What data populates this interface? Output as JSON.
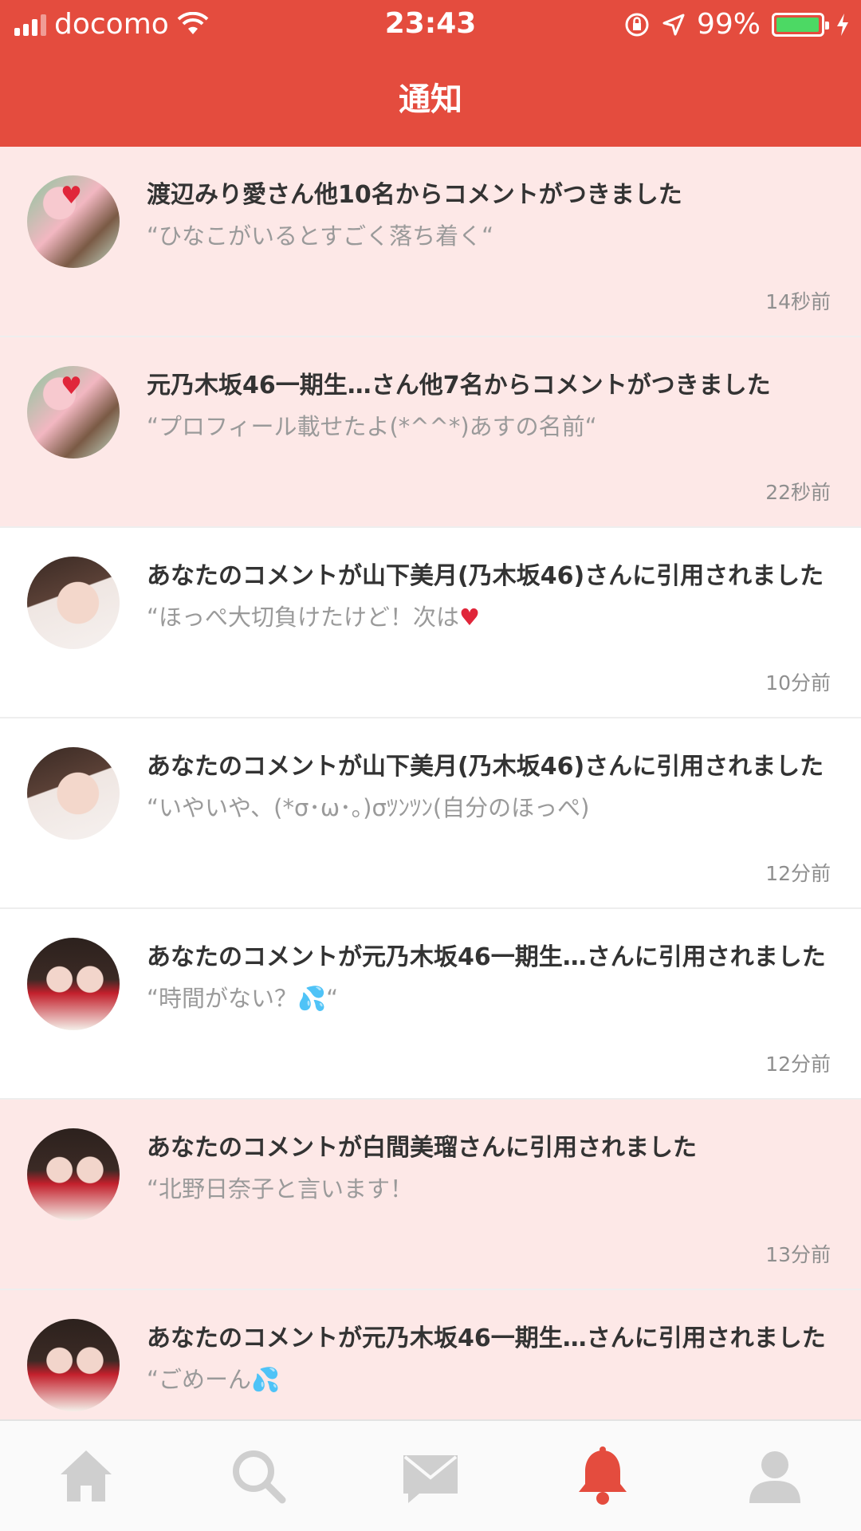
{
  "status_bar": {
    "carrier": "docomo",
    "time": "23:43",
    "battery": "99%"
  },
  "nav": {
    "title": "通知"
  },
  "notifications": [
    {
      "title": "渡辺みり愛さん他10名からコメントがつきました",
      "quote": "“ひなこがいるとすごく落ち着く“",
      "time": "14秒前"
    },
    {
      "title": "元乃木坂46一期生…さん他7名からコメントがつきました",
      "quote": "“プロフィール載せたよ(*^^*)あすの名前“",
      "time": "22秒前"
    },
    {
      "title": "あなたのコメントが山下美月(乃木坂46)さんに引用されました",
      "quote": "“ほっぺ大切負けたけど！次は",
      "time": "10分前"
    },
    {
      "title": "あなたのコメントが山下美月(乃木坂46)さんに引用されました",
      "quote": "“いやいや、(*σ･ω･。)σﾂﾝﾂﾝ(自分のほっぺ)",
      "time": "12分前"
    },
    {
      "title": "あなたのコメントが元乃木坂46一期生…さんに引用されました",
      "quote": "“時間がない？",
      "time": "12分前"
    },
    {
      "title": "あなたのコメントが白間美瑠さんに引用されました",
      "quote": "“北野日奈子と言います！",
      "time": "13分前"
    },
    {
      "title": "あなたのコメントが元乃木坂46一期生…さんに引用されました",
      "quote": "“ごめーん",
      "time": ""
    }
  ],
  "tabs": [
    {
      "name": "home-icon"
    },
    {
      "name": "search-icon"
    },
    {
      "name": "mail-icon"
    },
    {
      "name": "bell-icon"
    },
    {
      "name": "profile-icon"
    }
  ],
  "colors": {
    "accent": "#e44c3e",
    "unread_bg": "#fde8e7",
    "active_tab": "#e44c3e",
    "inactive_tab": "#cfcfcf"
  }
}
